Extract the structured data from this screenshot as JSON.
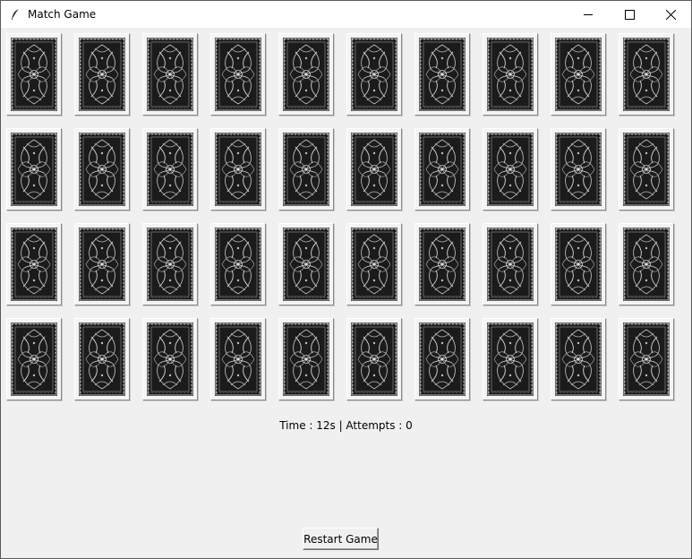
{
  "window": {
    "title": "Match Game",
    "app_icon": "feather-icon",
    "controls": [
      "minimize-icon",
      "maximize-icon",
      "close-icon"
    ]
  },
  "board": {
    "rows": 4,
    "columns": 10,
    "card_state": "face-down",
    "card_back_icon": "card-back-pattern-icon"
  },
  "status": {
    "text": "Time : 12s | Attempts : 0"
  },
  "restart_button": {
    "label": "Restart Game"
  },
  "colors": {
    "background": "#f0f0f0",
    "card_back": "#1c1c1c",
    "card_pattern": "#c8c8c8",
    "titlebar": "#ffffff"
  }
}
